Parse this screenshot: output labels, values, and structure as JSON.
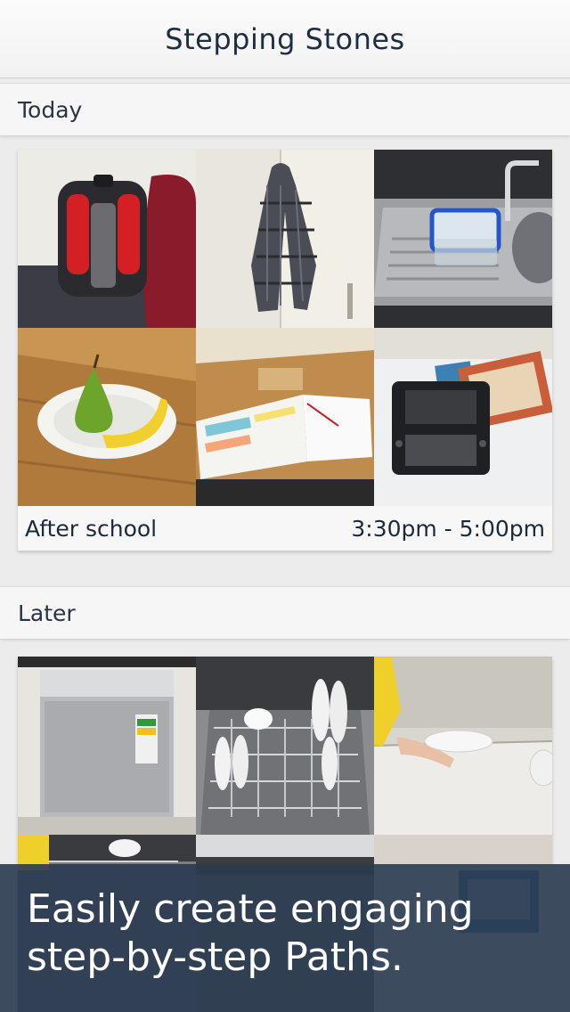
{
  "navbar": {
    "title": "Stepping Stones"
  },
  "sections": {
    "today": {
      "label": "Today",
      "path": {
        "name": "After school",
        "time": "3:30pm - 5:00pm",
        "images": [
          "backpack",
          "jacket-on-hook",
          "container-in-sink",
          "pear-and-banana",
          "homework-book",
          "handheld-game-console"
        ]
      }
    },
    "later": {
      "label": "Later",
      "path": {
        "images": [
          "dishwasher-closed",
          "dishwasher-open-rack",
          "putting-away-plates",
          "dishwasher-partial-1",
          "dishwasher-partial-2",
          "shelf-partial"
        ]
      }
    }
  },
  "banner": {
    "text": "Easily create engaging\nstep-by-step Paths."
  },
  "colors": {
    "navbar_title": "#1e2e42",
    "banner_bg": "#2a3a50",
    "banner_text": "#ffffff"
  }
}
